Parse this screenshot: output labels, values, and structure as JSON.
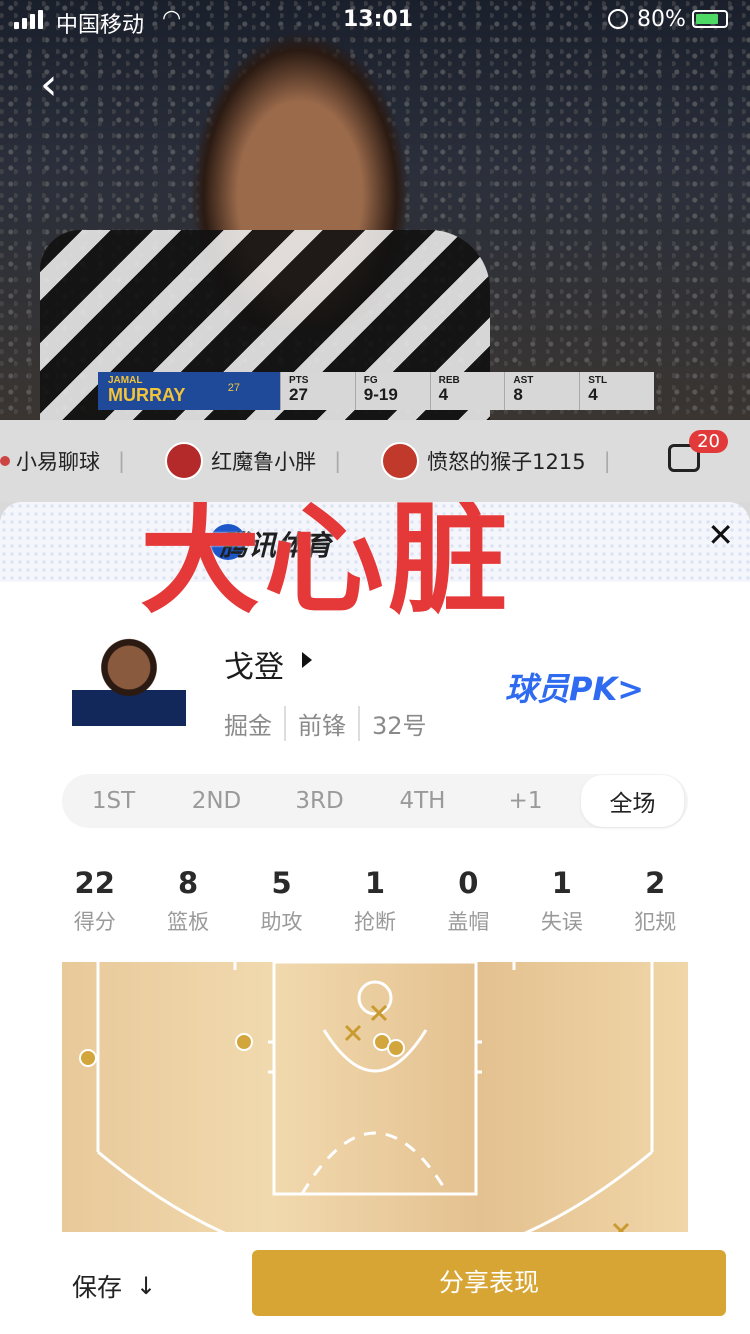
{
  "status_bar": {
    "carrier": "中国移动",
    "time": "13:01",
    "battery": "80%"
  },
  "video": {
    "scoreboard": {
      "first_name": "JAMAL",
      "last_name": "MURRAY",
      "number": "27",
      "stats": [
        {
          "key": "PTS",
          "value": "27"
        },
        {
          "key": "FG",
          "value": "9-19"
        },
        {
          "key": "REB",
          "value": "4"
        },
        {
          "key": "AST",
          "value": "8"
        },
        {
          "key": "STL",
          "value": "4"
        }
      ]
    }
  },
  "strip": {
    "items": [
      {
        "label": "小易聊球"
      },
      {
        "label": "红魔鲁小胖"
      },
      {
        "label": "愤怒的猴子1215"
      }
    ],
    "badge": "20"
  },
  "sheet": {
    "brand": "腾讯体育",
    "overlay_text": "大心脏",
    "player": {
      "name": "戈登",
      "team": "掘金",
      "position": "前锋",
      "jersey": "32号"
    },
    "pk_label": "球员PK>",
    "tabs": [
      {
        "label": "1ST"
      },
      {
        "label": "2ND"
      },
      {
        "label": "3RD"
      },
      {
        "label": "4TH"
      },
      {
        "label": "+1"
      },
      {
        "label": "全场"
      }
    ],
    "active_tab": "全场",
    "stats": [
      {
        "value": "22",
        "label": "得分"
      },
      {
        "value": "8",
        "label": "篮板"
      },
      {
        "value": "5",
        "label": "助攻"
      },
      {
        "value": "1",
        "label": "抢断"
      },
      {
        "value": "0",
        "label": "盖帽"
      },
      {
        "value": "1",
        "label": "失误"
      },
      {
        "value": "2",
        "label": "犯规"
      }
    ]
  },
  "footer": {
    "save_label": "保存",
    "share_label": "分享表现"
  },
  "colors": {
    "accent": "#d7a534",
    "pk": "#2e6bf1",
    "overlay": "#e53838"
  }
}
